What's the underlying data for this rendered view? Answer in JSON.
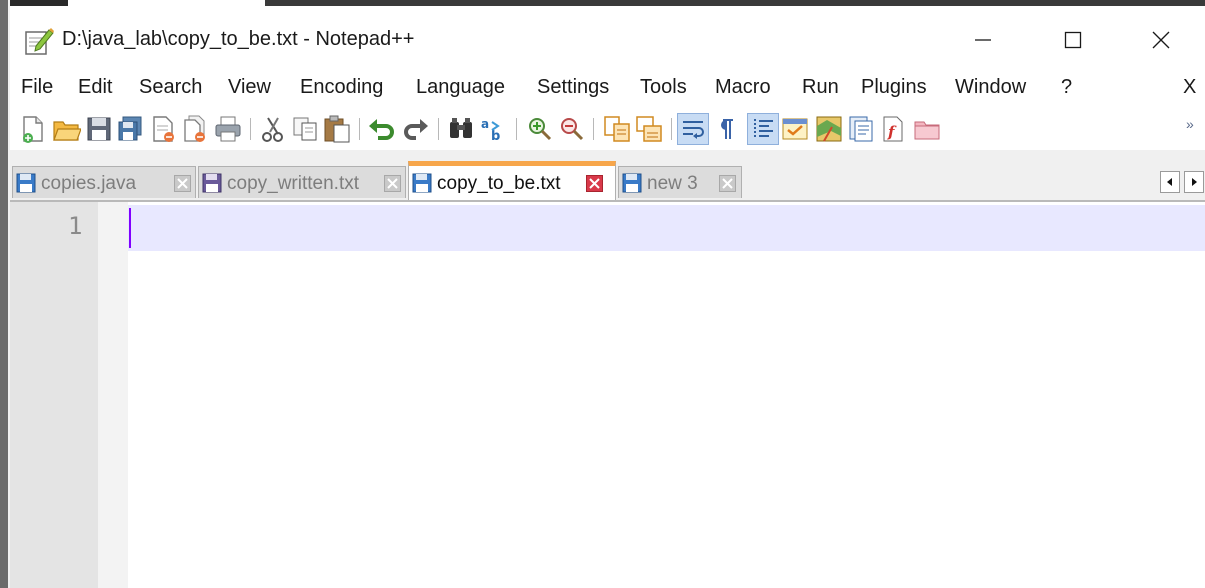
{
  "window": {
    "title": "D:\\java_lab\\copy_to_be.txt - Notepad++",
    "app_icon": "notepad-pencil-icon"
  },
  "menu": {
    "items": [
      "File",
      "Edit",
      "Search",
      "View",
      "Encoding",
      "Language",
      "Settings",
      "Tools",
      "Macro",
      "Run",
      "Plugins",
      "Window",
      "?"
    ],
    "close_document": "X"
  },
  "toolbar": {
    "overflow_label": "»",
    "buttons": [
      "new-file",
      "open-file",
      "save",
      "save-all",
      "close",
      "close-all",
      "print",
      "cut",
      "copy",
      "paste",
      "undo",
      "redo",
      "find",
      "replace",
      "zoom-in",
      "zoom-out",
      "sync-vertical",
      "sync-horizontal",
      "word-wrap",
      "show-all-characters",
      "indent-guide",
      "user-language",
      "document-map",
      "function-list",
      "folder-as-workspace",
      "monitoring"
    ]
  },
  "tabs": [
    {
      "label": "copies.java",
      "active": false
    },
    {
      "label": "copy_written.txt",
      "active": false
    },
    {
      "label": "copy_to_be.txt",
      "active": true
    },
    {
      "label": "new 3",
      "active": false
    }
  ],
  "editor": {
    "line_numbers": [
      "1"
    ],
    "content": ""
  },
  "colors": {
    "active_tab_accent": "#f7a64b",
    "current_line": "#e8e8ff",
    "caret": "#8000ff",
    "gutter": "#e4e4e4"
  }
}
